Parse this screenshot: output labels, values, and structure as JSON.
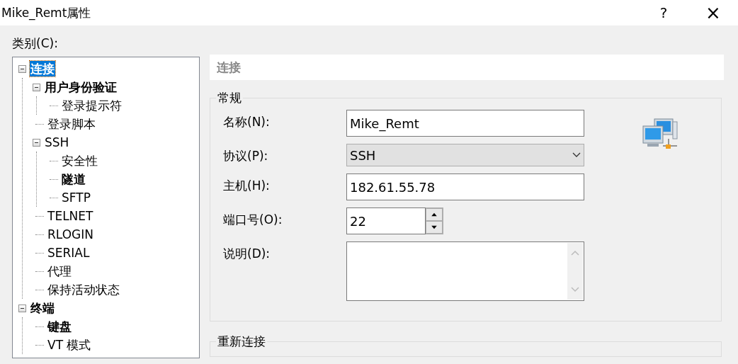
{
  "window": {
    "title": "Mike_Remt属性",
    "help": "?",
    "close": "×"
  },
  "category_label": "类别(C):",
  "tree": [
    {
      "label": "连接",
      "bold": true,
      "selected": true,
      "expanded": true,
      "children": [
        {
          "label": "用户身份验证",
          "bold": true,
          "selected": false,
          "expanded": true,
          "children": [
            {
              "label": "登录提示符",
              "bold": false,
              "selected": false
            }
          ]
        },
        {
          "label": "登录脚本",
          "bold": false,
          "selected": false
        },
        {
          "label": "SSH",
          "bold": false,
          "selected": false,
          "expanded": true,
          "children": [
            {
              "label": "安全性",
              "bold": false,
              "selected": false
            },
            {
              "label": "隧道",
              "bold": true,
              "selected": false
            },
            {
              "label": "SFTP",
              "bold": false,
              "selected": false
            }
          ]
        },
        {
          "label": "TELNET",
          "bold": false,
          "selected": false
        },
        {
          "label": "RLOGIN",
          "bold": false,
          "selected": false
        },
        {
          "label": "SERIAL",
          "bold": false,
          "selected": false
        },
        {
          "label": "代理",
          "bold": false,
          "selected": false
        },
        {
          "label": "保持活动状态",
          "bold": false,
          "selected": false
        }
      ]
    },
    {
      "label": "终端",
      "bold": true,
      "selected": false,
      "expanded": true,
      "children": [
        {
          "label": "键盘",
          "bold": true,
          "selected": false
        },
        {
          "label": "VT 模式",
          "bold": false,
          "selected": false
        }
      ]
    }
  ],
  "panel_title": "连接",
  "general": {
    "title": "常规",
    "fields": [
      {
        "kind": "text",
        "label": "名称(N):",
        "value": "Mike_Remt"
      },
      {
        "kind": "select",
        "label": "协议(P):",
        "value": "SSH"
      },
      {
        "kind": "text",
        "label": "主机(H):",
        "value": "182.61.55.78"
      },
      {
        "kind": "spin",
        "label": "端口号(O):",
        "value": "22"
      },
      {
        "kind": "textarea",
        "label": "说明(D):"
      }
    ]
  },
  "reconnect": {
    "title": "重新连接"
  }
}
